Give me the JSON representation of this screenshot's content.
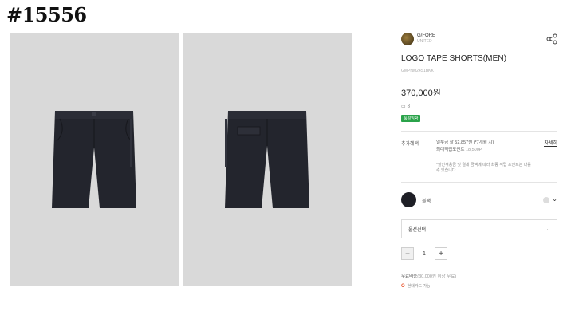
{
  "post_number": "#15556",
  "product": {
    "brand_name": "G/FORE",
    "brand_sub": "UNITED",
    "title": "LOGO TAPE SHORTS(MEN)",
    "code": "GMPNM24S1BKK",
    "price": "370,000원",
    "review_count": "8",
    "badge": "품절임박"
  },
  "benefits": {
    "label": "추가혜택",
    "installment": "일부금 할 52,857원 (*7개월 시)",
    "max_points_label": "최대적립포인트",
    "max_points_value": "18,500P",
    "note": "*할인적용금 및 결제 금액에 따라 최종 적립 포인트는 다를 수 있습니다.",
    "detail_link": "자세히"
  },
  "color": {
    "name": "블랙",
    "hex": "#1e1f26"
  },
  "option_select": {
    "placeholder": "옵션선택"
  },
  "quantity": {
    "value": "1",
    "minus": "−",
    "plus": "+"
  },
  "shipping": {
    "label": "무료배송",
    "condition": "(30,000원 이상 무료)"
  },
  "install": {
    "icon_text": "O",
    "label": "현대카드 가능"
  },
  "icons": {
    "share": "share-icon",
    "chevron": "chevron-down-icon"
  }
}
